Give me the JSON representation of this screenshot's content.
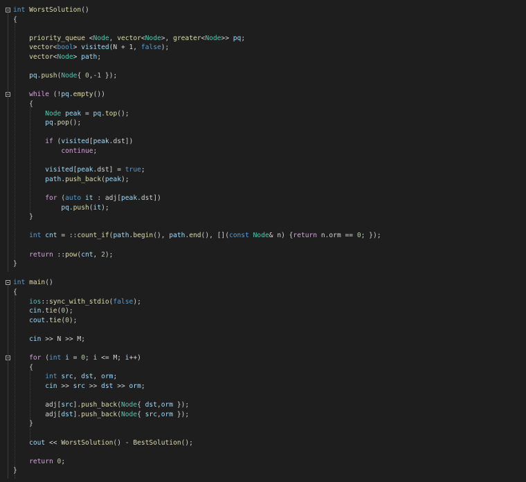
{
  "editor": {
    "colors": {
      "background": "#1e1e1e",
      "keyword": "#569cd6",
      "control": "#d8a0df",
      "function": "#dcdcaa",
      "type": "#4ec9b0",
      "variable": "#9cdcfe",
      "number": "#b5cea8",
      "text": "#d4d4d4"
    },
    "lines": [
      [
        [
          "kw",
          "int"
        ],
        [
          "plain",
          " "
        ],
        [
          "fn",
          "WorstSolution"
        ],
        [
          "plain",
          "()"
        ]
      ],
      [
        [
          "plain",
          "{"
        ]
      ],
      [],
      [
        [
          "plain",
          "    "
        ],
        [
          "fn",
          "priority_queue"
        ],
        [
          "plain",
          " <"
        ],
        [
          "ty",
          "Node"
        ],
        [
          "plain",
          ", "
        ],
        [
          "fn",
          "vector"
        ],
        [
          "plain",
          "<"
        ],
        [
          "ty",
          "Node"
        ],
        [
          "plain",
          ">, "
        ],
        [
          "fn",
          "greater"
        ],
        [
          "plain",
          "<"
        ],
        [
          "ty",
          "Node"
        ],
        [
          "plain",
          ">> "
        ],
        [
          "var",
          "pq"
        ],
        [
          "plain",
          ";"
        ]
      ],
      [
        [
          "plain",
          "    "
        ],
        [
          "fn",
          "vector"
        ],
        [
          "plain",
          "<"
        ],
        [
          "kw",
          "bool"
        ],
        [
          "plain",
          "> "
        ],
        [
          "var",
          "visited"
        ],
        [
          "plain",
          "(N + 1, "
        ],
        [
          "kw",
          "false"
        ],
        [
          "plain",
          ");"
        ]
      ],
      [
        [
          "plain",
          "    "
        ],
        [
          "fn",
          "vector"
        ],
        [
          "plain",
          "<"
        ],
        [
          "ty",
          "Node"
        ],
        [
          "plain",
          "> "
        ],
        [
          "var",
          "path"
        ],
        [
          "plain",
          ";"
        ]
      ],
      [],
      [
        [
          "plain",
          "    "
        ],
        [
          "var",
          "pq"
        ],
        [
          "plain",
          "."
        ],
        [
          "fn",
          "push"
        ],
        [
          "plain",
          "("
        ],
        [
          "ty",
          "Node"
        ],
        [
          "plain",
          "{ "
        ],
        [
          "num",
          "0"
        ],
        [
          "plain",
          ",-"
        ],
        [
          "num",
          "1"
        ],
        [
          "plain",
          " });"
        ]
      ],
      [],
      [
        [
          "plain",
          "    "
        ],
        [
          "ctrl",
          "while"
        ],
        [
          "plain",
          " (!"
        ],
        [
          "var",
          "pq"
        ],
        [
          "plain",
          "."
        ],
        [
          "fn",
          "empty"
        ],
        [
          "plain",
          "())"
        ]
      ],
      [
        [
          "plain",
          "    {"
        ]
      ],
      [
        [
          "plain",
          "        "
        ],
        [
          "ty",
          "Node"
        ],
        [
          "plain",
          " "
        ],
        [
          "var",
          "peak"
        ],
        [
          "plain",
          " = "
        ],
        [
          "var",
          "pq"
        ],
        [
          "plain",
          "."
        ],
        [
          "fn",
          "top"
        ],
        [
          "plain",
          "();"
        ]
      ],
      [
        [
          "plain",
          "        "
        ],
        [
          "var",
          "pq"
        ],
        [
          "plain",
          "."
        ],
        [
          "fn",
          "pop"
        ],
        [
          "plain",
          "();"
        ]
      ],
      [],
      [
        [
          "plain",
          "        "
        ],
        [
          "ctrl",
          "if"
        ],
        [
          "plain",
          " ("
        ],
        [
          "var",
          "visited"
        ],
        [
          "plain",
          "["
        ],
        [
          "var",
          "peak"
        ],
        [
          "plain",
          ".dst])"
        ]
      ],
      [
        [
          "plain",
          "            "
        ],
        [
          "ctrl",
          "continue"
        ],
        [
          "plain",
          ";"
        ]
      ],
      [],
      [
        [
          "plain",
          "        "
        ],
        [
          "var",
          "visited"
        ],
        [
          "plain",
          "["
        ],
        [
          "var",
          "peak"
        ],
        [
          "plain",
          ".dst] = "
        ],
        [
          "kw",
          "true"
        ],
        [
          "plain",
          ";"
        ]
      ],
      [
        [
          "plain",
          "        "
        ],
        [
          "var",
          "path"
        ],
        [
          "plain",
          "."
        ],
        [
          "fn",
          "push_back"
        ],
        [
          "plain",
          "("
        ],
        [
          "var",
          "peak"
        ],
        [
          "plain",
          ");"
        ]
      ],
      [],
      [
        [
          "plain",
          "        "
        ],
        [
          "ctrl",
          "for"
        ],
        [
          "plain",
          " ("
        ],
        [
          "kw",
          "auto"
        ],
        [
          "plain",
          " "
        ],
        [
          "var",
          "it"
        ],
        [
          "plain",
          " : adj["
        ],
        [
          "var",
          "peak"
        ],
        [
          "plain",
          ".dst])"
        ]
      ],
      [
        [
          "plain",
          "            "
        ],
        [
          "var",
          "pq"
        ],
        [
          "plain",
          "."
        ],
        [
          "fn",
          "push"
        ],
        [
          "plain",
          "("
        ],
        [
          "var",
          "it"
        ],
        [
          "plain",
          ");"
        ]
      ],
      [
        [
          "plain",
          "    }"
        ]
      ],
      [],
      [
        [
          "plain",
          "    "
        ],
        [
          "kw",
          "int"
        ],
        [
          "plain",
          " "
        ],
        [
          "var",
          "cnt"
        ],
        [
          "plain",
          " = ::"
        ],
        [
          "fn",
          "count_if"
        ],
        [
          "plain",
          "("
        ],
        [
          "var",
          "path"
        ],
        [
          "plain",
          "."
        ],
        [
          "fn",
          "begin"
        ],
        [
          "plain",
          "(), "
        ],
        [
          "var",
          "path"
        ],
        [
          "plain",
          "."
        ],
        [
          "fn",
          "end"
        ],
        [
          "plain",
          "(), []("
        ],
        [
          "kw",
          "const"
        ],
        [
          "plain",
          " "
        ],
        [
          "ty",
          "Node"
        ],
        [
          "plain",
          "& n) {"
        ],
        [
          "ctrl",
          "return"
        ],
        [
          "plain",
          " n.orm == "
        ],
        [
          "num",
          "0"
        ],
        [
          "plain",
          "; });"
        ]
      ],
      [],
      [
        [
          "plain",
          "    "
        ],
        [
          "ctrl",
          "return"
        ],
        [
          "plain",
          " ::"
        ],
        [
          "fn",
          "pow"
        ],
        [
          "plain",
          "("
        ],
        [
          "var",
          "cnt"
        ],
        [
          "plain",
          ", "
        ],
        [
          "num",
          "2"
        ],
        [
          "plain",
          ");"
        ]
      ],
      [
        [
          "plain",
          "}"
        ]
      ],
      [],
      [
        [
          "kw",
          "int"
        ],
        [
          "plain",
          " "
        ],
        [
          "fn",
          "main"
        ],
        [
          "plain",
          "()"
        ]
      ],
      [
        [
          "plain",
          "{"
        ]
      ],
      [
        [
          "plain",
          "    "
        ],
        [
          "ty",
          "ios"
        ],
        [
          "plain",
          "::"
        ],
        [
          "fn",
          "sync_with_stdio"
        ],
        [
          "plain",
          "("
        ],
        [
          "kw",
          "false"
        ],
        [
          "plain",
          ");"
        ]
      ],
      [
        [
          "plain",
          "    "
        ],
        [
          "var",
          "cin"
        ],
        [
          "plain",
          "."
        ],
        [
          "fn",
          "tie"
        ],
        [
          "plain",
          "("
        ],
        [
          "num",
          "0"
        ],
        [
          "plain",
          ");"
        ]
      ],
      [
        [
          "plain",
          "    "
        ],
        [
          "var",
          "cout"
        ],
        [
          "plain",
          "."
        ],
        [
          "fn",
          "tie"
        ],
        [
          "plain",
          "("
        ],
        [
          "num",
          "0"
        ],
        [
          "plain",
          ");"
        ]
      ],
      [],
      [
        [
          "plain",
          "    "
        ],
        [
          "var",
          "cin"
        ],
        [
          "plain",
          " >> N >> M;"
        ]
      ],
      [],
      [
        [
          "plain",
          "    "
        ],
        [
          "ctrl",
          "for"
        ],
        [
          "plain",
          " ("
        ],
        [
          "kw",
          "int"
        ],
        [
          "plain",
          " "
        ],
        [
          "var",
          "i"
        ],
        [
          "plain",
          " = "
        ],
        [
          "num",
          "0"
        ],
        [
          "plain",
          "; "
        ],
        [
          "var",
          "i"
        ],
        [
          "plain",
          " <= M; "
        ],
        [
          "var",
          "i"
        ],
        [
          "plain",
          "++)"
        ]
      ],
      [
        [
          "plain",
          "    {"
        ]
      ],
      [
        [
          "plain",
          "        "
        ],
        [
          "kw",
          "int"
        ],
        [
          "plain",
          " "
        ],
        [
          "var",
          "src"
        ],
        [
          "plain",
          ", "
        ],
        [
          "var",
          "dst"
        ],
        [
          "plain",
          ", "
        ],
        [
          "var",
          "orm"
        ],
        [
          "plain",
          ";"
        ]
      ],
      [
        [
          "plain",
          "        "
        ],
        [
          "var",
          "cin"
        ],
        [
          "plain",
          " >> "
        ],
        [
          "var",
          "src"
        ],
        [
          "plain",
          " >> "
        ],
        [
          "var",
          "dst"
        ],
        [
          "plain",
          " >> "
        ],
        [
          "var",
          "orm"
        ],
        [
          "plain",
          ";"
        ]
      ],
      [],
      [
        [
          "plain",
          "        adj["
        ],
        [
          "var",
          "src"
        ],
        [
          "plain",
          "]."
        ],
        [
          "fn",
          "push_back"
        ],
        [
          "plain",
          "("
        ],
        [
          "ty",
          "Node"
        ],
        [
          "plain",
          "{ "
        ],
        [
          "var",
          "dst"
        ],
        [
          "plain",
          ","
        ],
        [
          "var",
          "orm"
        ],
        [
          "plain",
          " });"
        ]
      ],
      [
        [
          "plain",
          "        adj["
        ],
        [
          "var",
          "dst"
        ],
        [
          "plain",
          "]."
        ],
        [
          "fn",
          "push_back"
        ],
        [
          "plain",
          "("
        ],
        [
          "ty",
          "Node"
        ],
        [
          "plain",
          "{ "
        ],
        [
          "var",
          "src"
        ],
        [
          "plain",
          ","
        ],
        [
          "var",
          "orm"
        ],
        [
          "plain",
          " });"
        ]
      ],
      [
        [
          "plain",
          "    }"
        ]
      ],
      [],
      [
        [
          "plain",
          "    "
        ],
        [
          "var",
          "cout"
        ],
        [
          "plain",
          " << "
        ],
        [
          "fn",
          "WorstSolution"
        ],
        [
          "plain",
          "() - "
        ],
        [
          "fn",
          "BestSolution"
        ],
        [
          "plain",
          "();"
        ]
      ],
      [],
      [
        [
          "plain",
          "    "
        ],
        [
          "ctrl",
          "return"
        ],
        [
          "plain",
          " "
        ],
        [
          "num",
          "0"
        ],
        [
          "plain",
          ";"
        ]
      ],
      [
        [
          "plain",
          "}"
        ]
      ]
    ]
  },
  "fold_markers": [
    {
      "line": 0,
      "icon": "minus-box-icon"
    },
    {
      "line": 9,
      "icon": "minus-box-icon"
    },
    {
      "line": 29,
      "icon": "minus-box-icon"
    },
    {
      "line": 37,
      "icon": "minus-box-icon"
    }
  ]
}
